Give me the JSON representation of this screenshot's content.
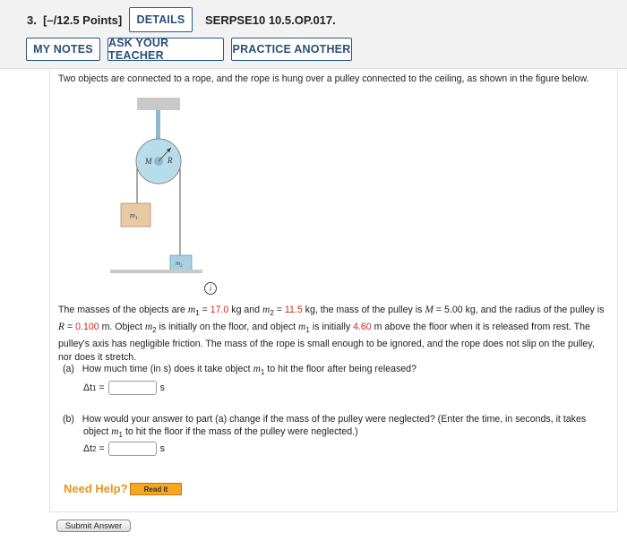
{
  "question": {
    "number": "3.",
    "points": "[–/12.5 Points]",
    "details_label": "DETAILS",
    "code": "SERPSE10 10.5.OP.017."
  },
  "toolbar": {
    "my_notes": "MY NOTES",
    "ask_teacher": "ASK YOUR TEACHER",
    "practice_another": "PRACTICE ANOTHER"
  },
  "intro": "Two objects are connected to a rope, and the rope is hung over a pulley connected to the ceiling, as shown in the figure below.",
  "figure": {
    "pulley_mass_label": "M",
    "pulley_radius_label": "R",
    "m1_label": "m",
    "m1_sub": "1",
    "m2_label": "m",
    "m2_sub": "2"
  },
  "info_icon": "i",
  "values": {
    "m1": "17.0",
    "m2": "11.5",
    "M": "5.00",
    "R": "0.100",
    "height": "4.60"
  },
  "part_a": {
    "label": "(a)",
    "question": "How much time (in s) does it take object",
    "question_end": "to hit the floor after being released?",
    "answer_label": "Δt",
    "answer_sub": "1",
    "unit": "s"
  },
  "part_b": {
    "label": "(b)",
    "question": "How would your answer to part (a) change if the mass of the pulley were neglected? (Enter the time, in seconds, it takes",
    "question_line2": "to hit the floor if the mass of the pulley were neglected.)",
    "answer_label": "Δt",
    "answer_sub": "2",
    "unit": "s"
  },
  "help": {
    "need_help": "Need Help?",
    "read_it": "Read It"
  },
  "submit_label": "Submit Answer",
  "colors": {
    "accent": "#2a5a8a",
    "given_value": "#cc2a1f",
    "help": "#e8941a",
    "read_it_bg": "#f5a623"
  }
}
